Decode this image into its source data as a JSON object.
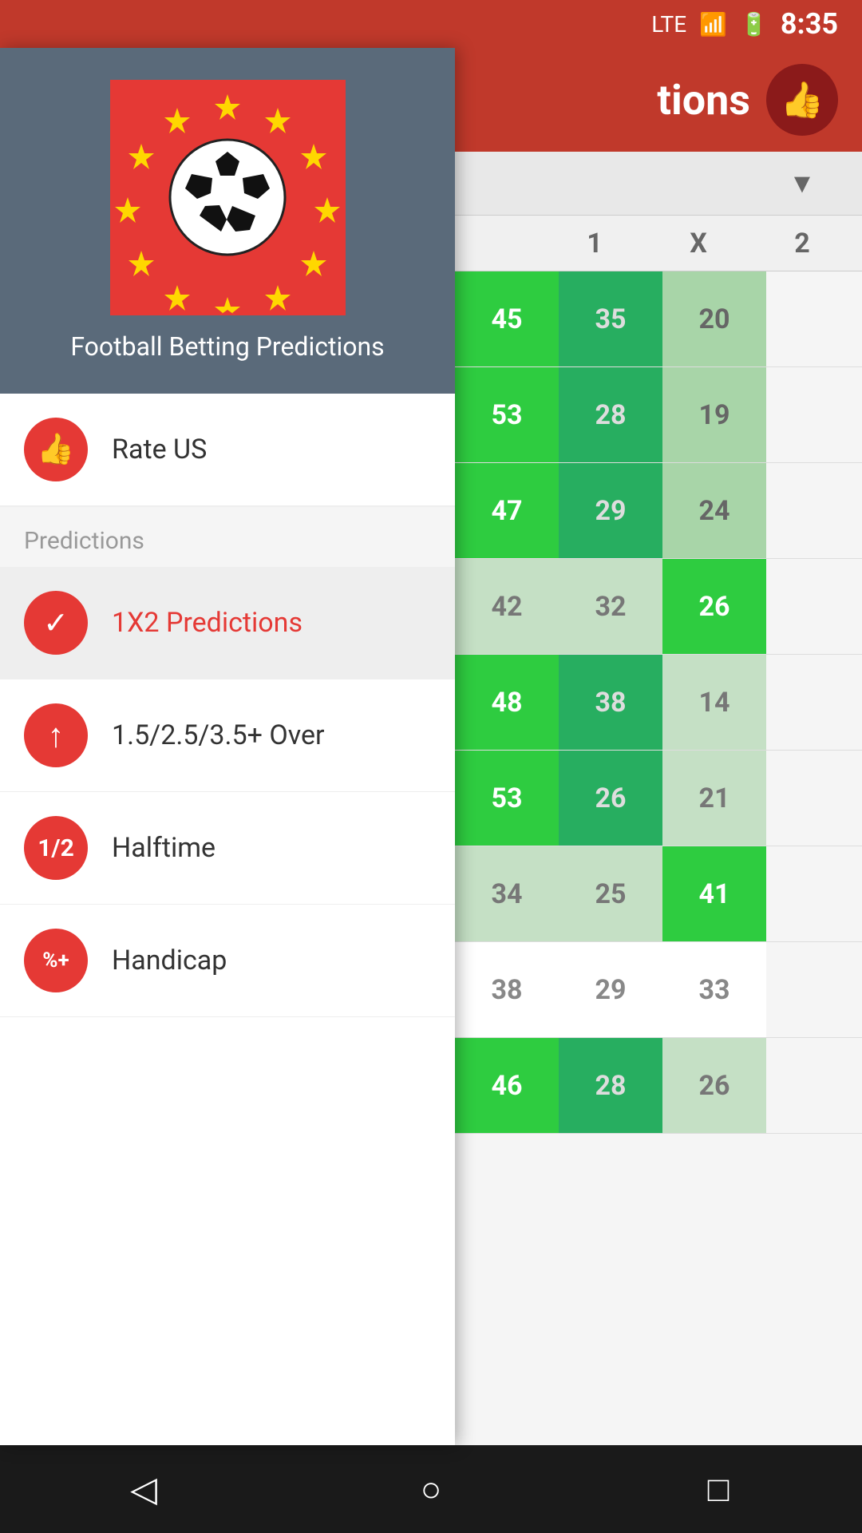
{
  "statusBar": {
    "time": "8:35",
    "icons": [
      "LTE",
      "signal",
      "battery"
    ]
  },
  "header": {
    "title": "tions",
    "thumbsUpIcon": "👍"
  },
  "drawer": {
    "logoTitle": "Football Betting Predictions",
    "menuItems": [
      {
        "id": "rate-us",
        "icon": "👍",
        "iconType": "thumbs",
        "label": "Rate US",
        "active": false
      }
    ],
    "sections": [
      {
        "header": "Predictions",
        "items": [
          {
            "id": "1x2",
            "icon": "✓",
            "iconType": "check",
            "label": "1X2 Predictions",
            "active": true
          },
          {
            "id": "over",
            "icon": "↑",
            "iconType": "up",
            "label": "1.5/2.5/3.5+ Over",
            "active": false
          },
          {
            "id": "halftime",
            "icon": "½",
            "iconType": "half",
            "label": "Halftime",
            "active": false
          },
          {
            "id": "handicap",
            "icon": "%+",
            "iconType": "percent",
            "label": "Handicap",
            "active": false
          }
        ]
      }
    ]
  },
  "table": {
    "columns": [
      "1",
      "X",
      "2"
    ],
    "rows": [
      {
        "col1": "45",
        "colX": "35",
        "col2": "20",
        "col1Bright": true,
        "colXBright": true,
        "col2Bright": false
      },
      {
        "col1": "53",
        "colX": "28",
        "col2": "19",
        "col1Bright": true,
        "colXBright": false,
        "col2Bright": false
      },
      {
        "col1": "47",
        "colX": "29",
        "col2": "24",
        "col1Bright": true,
        "colXBright": false,
        "col2Bright": false
      },
      {
        "col1": "42",
        "colX": "32",
        "col2": "26",
        "col1Bright": false,
        "colXBright": false,
        "col2Bright": true
      },
      {
        "col1": "48",
        "colX": "38",
        "col2": "14",
        "col1Bright": true,
        "colXBright": false,
        "col2Bright": false
      },
      {
        "col1": "53",
        "colX": "26",
        "col2": "21",
        "col1Bright": true,
        "colXBright": false,
        "col2Bright": false
      },
      {
        "col1": "34",
        "colX": "25",
        "col2": "41",
        "col1Bright": false,
        "colXBright": false,
        "col2Bright": true
      },
      {
        "col1": "38",
        "colX": "29",
        "col2": "33",
        "col1Bright": false,
        "colXBright": false,
        "col2Bright": false
      },
      {
        "col1": "46",
        "colX": "28",
        "col2": "26",
        "col1Bright": true,
        "colXBright": false,
        "col2Bright": false
      }
    ]
  },
  "bottomNav": {
    "buttons": [
      "back",
      "home",
      "recent"
    ]
  }
}
